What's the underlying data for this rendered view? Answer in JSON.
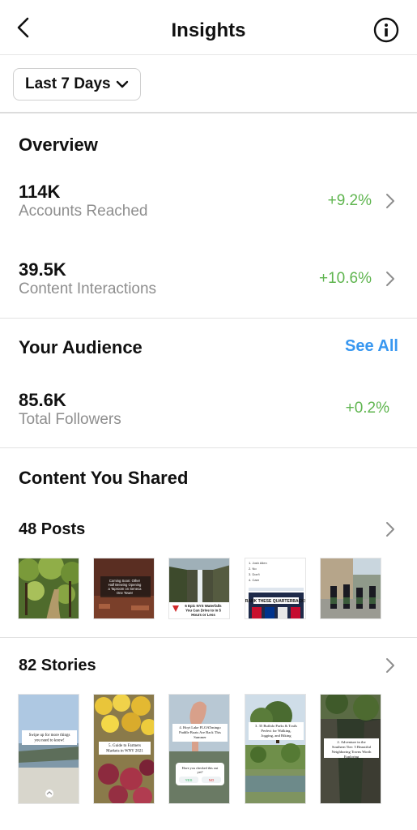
{
  "header": {
    "title": "Insights"
  },
  "filter": {
    "label": "Last 7 Days"
  },
  "overview": {
    "title": "Overview",
    "rows": [
      {
        "value": "114K",
        "label": "Accounts Reached",
        "delta": "+9.2%"
      },
      {
        "value": "39.5K",
        "label": "Content Interactions",
        "delta": "+10.6%"
      }
    ]
  },
  "audience": {
    "title": "Your Audience",
    "see_all": "See All",
    "value": "85.6K",
    "label": "Total Followers",
    "delta": "+0.2%"
  },
  "content": {
    "title": "Content You Shared",
    "posts_label": "48 Posts",
    "stories_label": "82 Stories",
    "posts": [
      {
        "icon": "garden-path-photo"
      },
      {
        "icon": "taproom-photo",
        "text": "Coming Soon: Other Half Brewing Opening a Taproom on Seneca One Tower"
      },
      {
        "icon": "waterfall-photo",
        "text": "6 Epic NYS Waterfalls You Can Drive to in 5 Hours or Less"
      },
      {
        "icon": "quarterback-list-photo",
        "lines": [
          "1. Josh Allen",
          "2. No",
          "3. Don't",
          "4. Care"
        ],
        "banner": "RANK THESE QUARTERBACKS"
      },
      {
        "icon": "bagpipers-photo"
      }
    ],
    "stories": [
      {
        "icon": "waterfront-photo",
        "text": "Swipe up for more things you need to know!"
      },
      {
        "icon": "farmers-market-photo",
        "text": "5. Guide to Farmers Markets in WNY 2021"
      },
      {
        "icon": "flamingo-boats-photo",
        "text": "4. Hoyt Lake FLOATmingo Paddle Boats Are Back This Summer",
        "poll_q": "Have you checked this out yet?",
        "poll_yes": "YES",
        "poll_no": "NO"
      },
      {
        "icon": "park-trails-photo",
        "text": "3. 35 Buffalo Parks & Trails Perfect for Walking, Jogging, and Biking"
      },
      {
        "icon": "gorge-photo",
        "text": "2. Adventure in the Southern Tier: 5 Beautiful Neighboring Towns Worth Exploring"
      }
    ]
  },
  "colors": {
    "positive": "#5fb54f",
    "link": "#3897f0"
  }
}
